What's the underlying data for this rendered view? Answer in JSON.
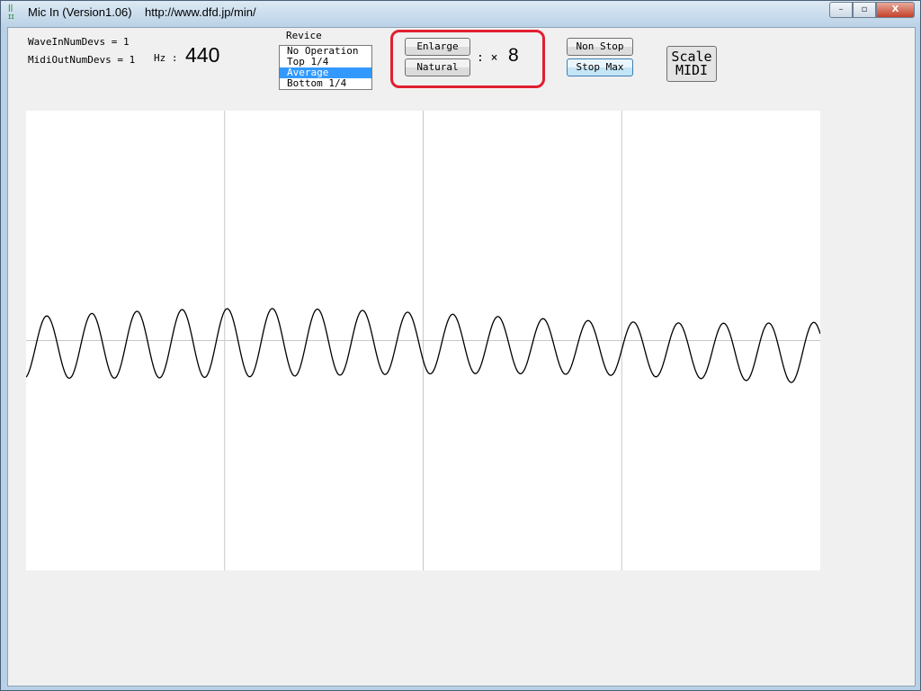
{
  "window": {
    "title": "Mic In (Version1.06)    http://www.dfd.jp/min/",
    "controls": {
      "minimize": "–",
      "maximize": "▫",
      "close": "X"
    }
  },
  "info": {
    "wave_in": "WaveInNumDevs = 1",
    "midi_out": "MidiOutNumDevs = 1",
    "hz_label": "Hz :",
    "hz_value": "440"
  },
  "revice": {
    "label": "Revice",
    "options": [
      "No Operation",
      "Top 1/4",
      "Average",
      "Bottom 1/4"
    ],
    "selected": "Average"
  },
  "zoom": {
    "enlarge": "Enlarge",
    "natural": "Natural",
    "factor_label": ": ×",
    "factor": "8"
  },
  "stop": {
    "non_stop": "Non Stop",
    "stop_max": "Stop Max"
  },
  "scale_midi": {
    "line1": "Scale",
    "line2": "MIDI"
  },
  "waveform": {
    "cycles": 17.6,
    "gridlines_vertical": 3,
    "gridline_horizontal": "center"
  }
}
